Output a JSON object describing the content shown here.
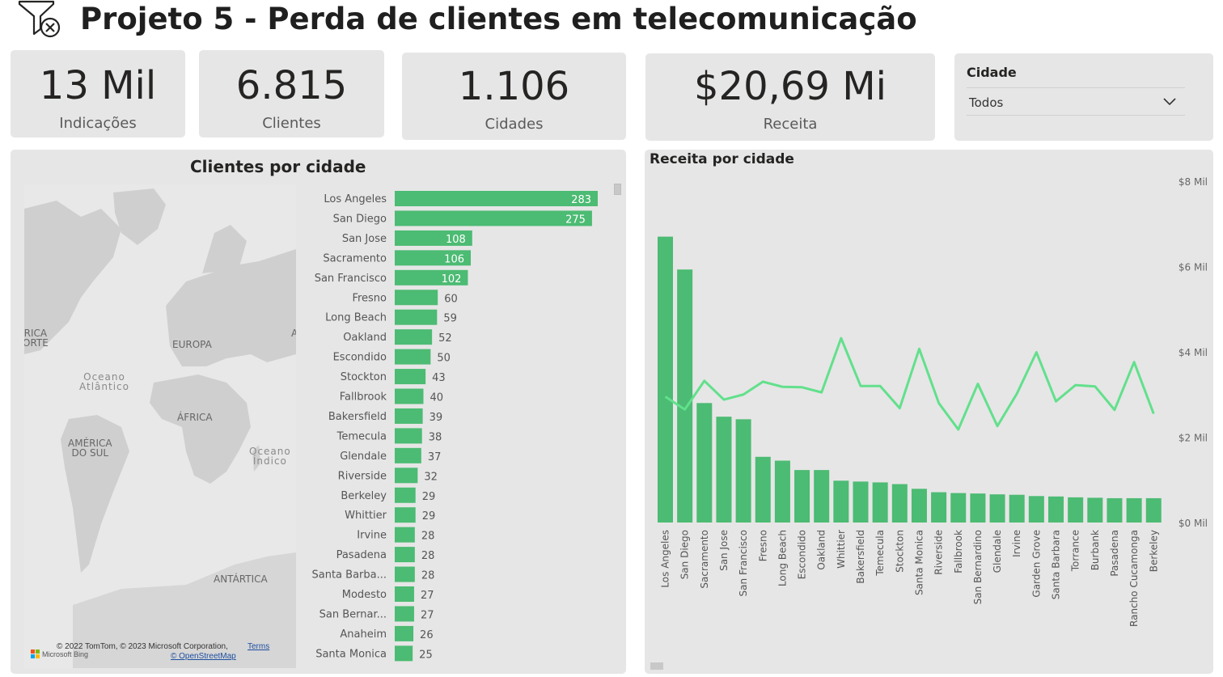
{
  "header": {
    "title": "Projeto 5 - Perda de clientes em telecomunicação",
    "icon": "filter-clear-icon"
  },
  "kpis": [
    {
      "value": "13 Mil",
      "label": "Indicações"
    },
    {
      "value": "6.815",
      "label": "Clientes"
    },
    {
      "value": "1.106",
      "label": "Cidades"
    },
    {
      "value": "$20,69 Mi",
      "label": "Receita"
    }
  ],
  "slicer": {
    "title": "Cidade",
    "value": "Todos",
    "icon": "chevron-down-icon"
  },
  "map_panel": {
    "title": "Clientes por cidade",
    "labels": {
      "america_norte_1": "RICA",
      "america_norte_2": "ORTE",
      "europa": "EUROPA",
      "oceano_atlantico_1": "Oceano",
      "oceano_atlantico_2": "Atlântico",
      "africa": "ÁFRICA",
      "america_sul_1": "AMÉRICA",
      "america_sul_2": "DO SUL",
      "oceano_indico_1": "Oceano",
      "oceano_indico_2": "Índico",
      "antartica": "ANTÁRTICA",
      "asia_cut": "A"
    },
    "attribution": "© 2022 TomTom, © 2023 Microsoft Corporation,",
    "terms": "Terms",
    "osm": "© OpenStreetMap",
    "bing": "Microsoft Bing"
  },
  "receita_panel": {
    "title": "Receita por cidade"
  },
  "colors": {
    "bar": "#4cbb73",
    "line": "#62e08c",
    "card": "#e6e6e6"
  },
  "chart_data": [
    {
      "type": "bar",
      "orientation": "horizontal",
      "title": "Clientes por cidade",
      "categories": [
        "Los Angeles",
        "San Diego",
        "San Jose",
        "Sacramento",
        "San Francisco",
        "Fresno",
        "Long Beach",
        "Oakland",
        "Escondido",
        "Stockton",
        "Fallbrook",
        "Bakersfield",
        "Temecula",
        "Glendale",
        "Riverside",
        "Berkeley",
        "Whittier",
        "Irvine",
        "Pasadena",
        "Santa Barba...",
        "Modesto",
        "San Bernar...",
        "Anaheim",
        "Santa Monica"
      ],
      "values": [
        283,
        275,
        108,
        106,
        102,
        60,
        59,
        52,
        50,
        43,
        40,
        39,
        38,
        37,
        32,
        29,
        29,
        28,
        28,
        28,
        27,
        27,
        26,
        25
      ],
      "xlim": [
        0,
        283
      ]
    },
    {
      "type": "bar",
      "title": "Receita por cidade",
      "categories": [
        "Los Angeles",
        "San Diego",
        "Sacramento",
        "San Jose",
        "San Francisco",
        "Fresno",
        "Long Beach",
        "Escondido",
        "Oakland",
        "Whittier",
        "Bakersfield",
        "Temecula",
        "Stockton",
        "Santa Monica",
        "Riverside",
        "Fallbrook",
        "San Bernardino",
        "Glendale",
        "Irvine",
        "Garden Grove",
        "Santa Barbara",
        "Torrance",
        "Burbank",
        "Pasadena",
        "Rancho Cucamonga",
        "Berkeley"
      ],
      "values": [
        6700,
        5930,
        2800,
        2480,
        2420,
        1540,
        1450,
        1230,
        1230,
        980,
        960,
        940,
        900,
        790,
        710,
        690,
        680,
        660,
        650,
        620,
        610,
        590,
        580,
        570,
        570,
        570
      ],
      "yticks": [
        "$0 Mil",
        "$2 Mil",
        "$4 Mil",
        "$6 Mil",
        "$8 Mil"
      ],
      "ylim": [
        0,
        8000
      ],
      "line": [
        2950,
        2650,
        3320,
        2880,
        3000,
        3300,
        3180,
        3170,
        3050,
        4320,
        3200,
        3200,
        2680,
        4070,
        2800,
        2180,
        3250,
        2260,
        3020,
        3990,
        2840,
        3220,
        3190,
        2640,
        3760,
        2550
      ],
      "grid": false,
      "legend": "none"
    }
  ]
}
